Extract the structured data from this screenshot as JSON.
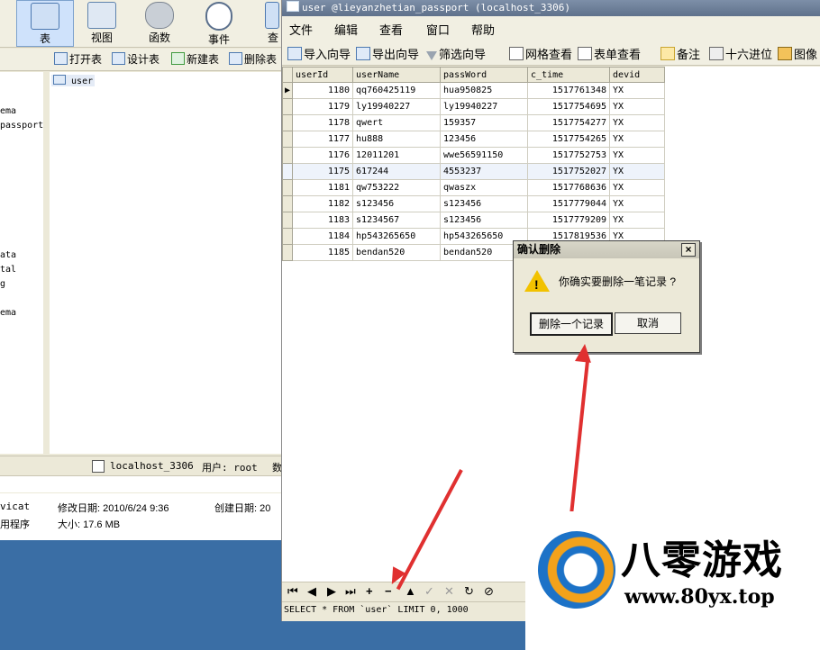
{
  "bg_window": {
    "toolbar": [
      {
        "label": "表",
        "icon": "table-icon",
        "active": true
      },
      {
        "label": "视图",
        "icon": "view-icon"
      },
      {
        "label": "函数",
        "icon": "function-icon"
      },
      {
        "label": "事件",
        "icon": "event-clock-icon"
      },
      {
        "label": "查",
        "icon": "query-icon"
      }
    ],
    "subtoolbar": [
      "打开表",
      "设计表",
      "新建表",
      "删除表"
    ],
    "tree_items": [
      "ema",
      "passport",
      "ata",
      "tal",
      "g",
      "ema"
    ],
    "object_item": "user",
    "status": {
      "connection": "localhost_3306",
      "user": "用户: root",
      "extra": "数"
    },
    "info": {
      "app": "vicat",
      "modified": "修改日期: 2010/6/24 9:36",
      "created": "创建日期: 20",
      "app2": "用程序",
      "size": "大小: 17.6 MB"
    }
  },
  "window": {
    "title": "user @lieyanzhetian_passport (localhost_3306)",
    "menu": [
      "文件",
      "编辑",
      "查看",
      "窗口",
      "帮助"
    ],
    "toolbar": [
      "导入向导",
      "导出向导",
      "筛选向导",
      "网格查看",
      "表单查看",
      "备注",
      "十六进位",
      "图像"
    ]
  },
  "table": {
    "columns": [
      "userId",
      "userName",
      "passWord",
      "c_time",
      "devid"
    ],
    "rows": [
      [
        "1180",
        "qq760425119",
        "hua950825",
        "1517761348",
        "YX"
      ],
      [
        "1179",
        "ly19940227",
        "ly19940227",
        "1517754695",
        "YX"
      ],
      [
        "1178",
        "qwert",
        "159357",
        "1517754277",
        "YX"
      ],
      [
        "1177",
        "hu888",
        "123456",
        "1517754265",
        "YX"
      ],
      [
        "1176",
        "12011201",
        "wwe56591150",
        "1517752753",
        "YX"
      ],
      [
        "1175",
        "617244",
        "4553237",
        "1517752027",
        "YX"
      ],
      [
        "1181",
        "qw753222",
        "qwaszx",
        "1517768636",
        "YX"
      ],
      [
        "1182",
        "s123456",
        "s123456",
        "1517779044",
        "YX"
      ],
      [
        "1183",
        "s1234567",
        "s123456",
        "1517779209",
        "YX"
      ],
      [
        "1184",
        "hp543265650",
        "hp543265650",
        "1517819536",
        "YX"
      ],
      [
        "1185",
        "bendan520",
        "bendan520",
        "",
        ""
      ]
    ]
  },
  "navbar": [
    "⏮",
    "◀",
    "▶",
    "⏭",
    "+",
    "−",
    "▲",
    "✓",
    "✕",
    "↻",
    "⊘"
  ],
  "sql": "SELECT * FROM `user` LIMIT 0, 1000",
  "dialog": {
    "title": "确认删除",
    "message": "你确实要删除一笔记录 ?",
    "confirm": "删除一个记录",
    "cancel": "取消"
  },
  "watermark": {
    "name": "八零游戏",
    "url": "www.80yx.top"
  },
  "colors": {
    "arrow": "#e03030",
    "title_bar": "#6a7c96",
    "accent": "#1c72c7"
  }
}
